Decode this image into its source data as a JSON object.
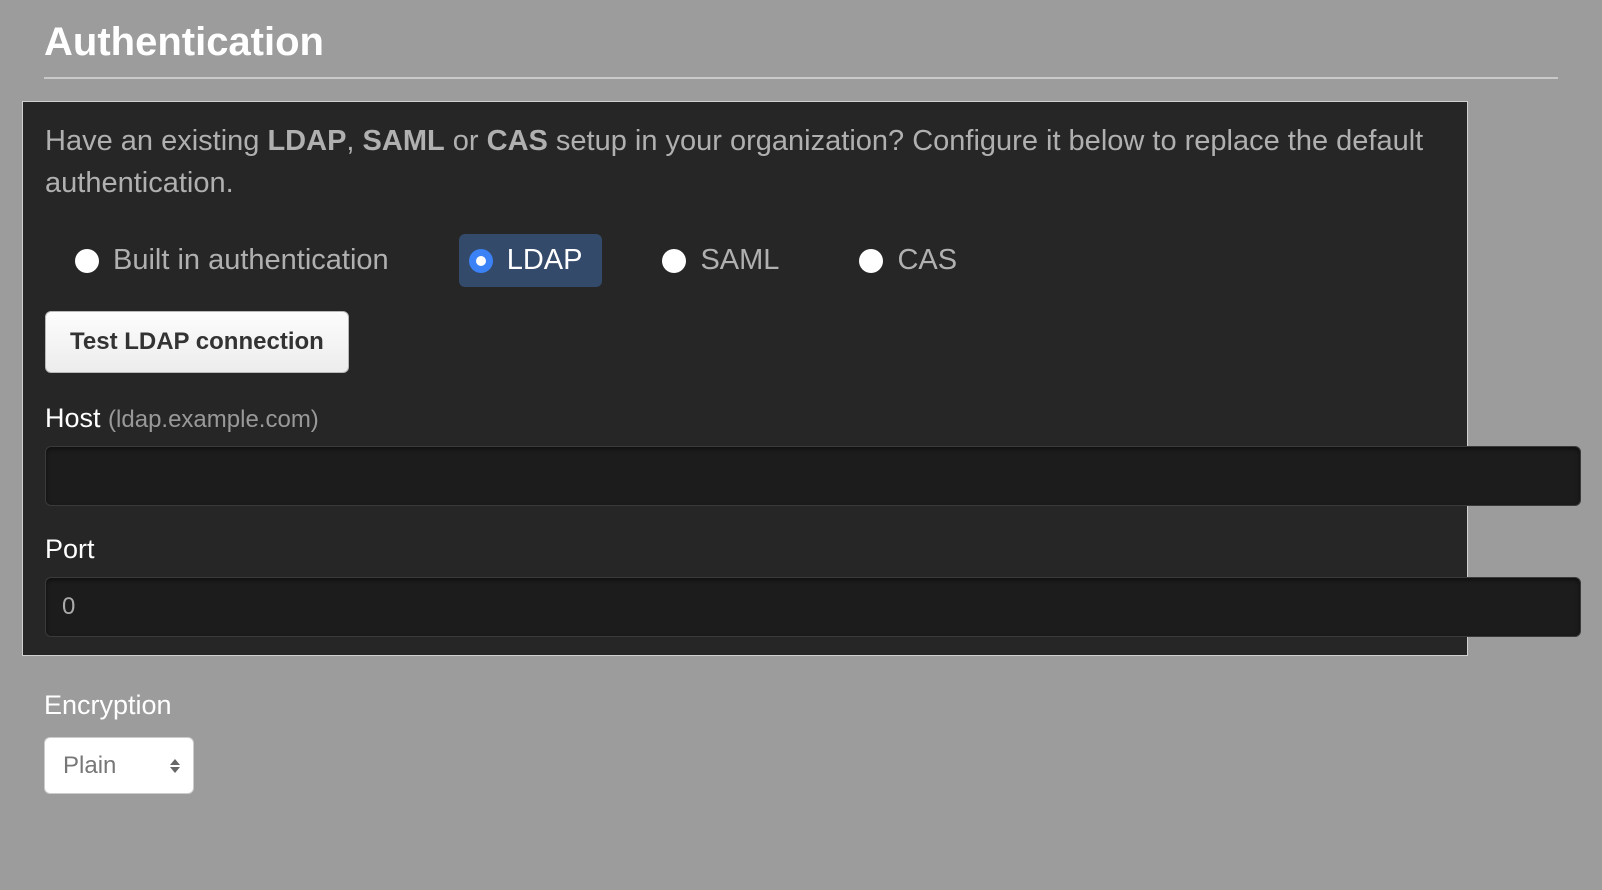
{
  "header": {
    "title": "Authentication"
  },
  "intro": {
    "prefix": "Have an existing ",
    "b1": "LDAP",
    "sep1": ", ",
    "b2": "SAML",
    "sep2": " or ",
    "b3": "CAS",
    "suffix": " setup in your organization? Configure it below to replace the default authentication."
  },
  "authTypes": {
    "builtin": "Built in authentication",
    "ldap": "LDAP",
    "saml": "SAML",
    "cas": "CAS",
    "selected": "ldap"
  },
  "buttons": {
    "testLdap": "Test LDAP connection"
  },
  "fields": {
    "host": {
      "label": "Host",
      "hint": "(ldap.example.com)",
      "value": ""
    },
    "port": {
      "label": "Port",
      "value": "0"
    },
    "encryption": {
      "label": "Encryption",
      "selected": "Plain"
    }
  }
}
